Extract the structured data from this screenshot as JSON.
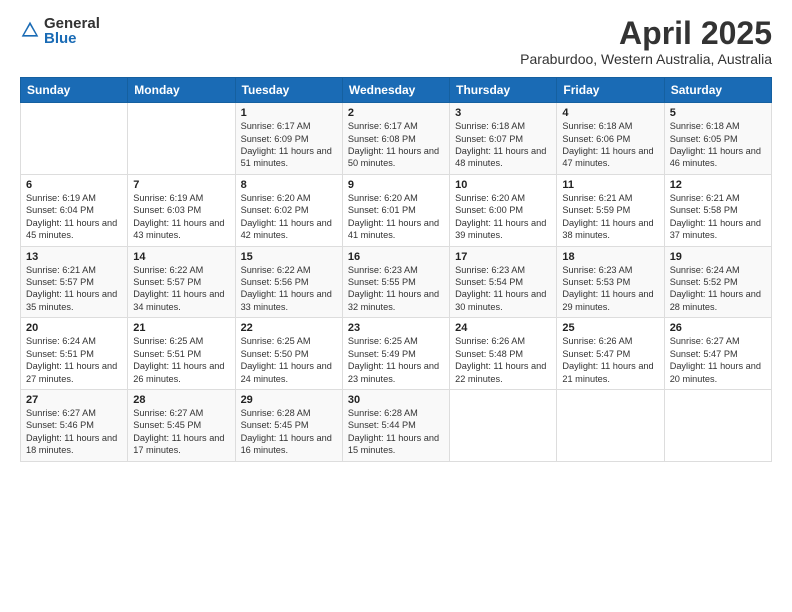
{
  "header": {
    "logo_general": "General",
    "logo_blue": "Blue",
    "month_title": "April 2025",
    "subtitle": "Paraburdoo, Western Australia, Australia"
  },
  "calendar": {
    "days_of_week": [
      "Sunday",
      "Monday",
      "Tuesday",
      "Wednesday",
      "Thursday",
      "Friday",
      "Saturday"
    ],
    "weeks": [
      [
        {
          "num": "",
          "info": ""
        },
        {
          "num": "",
          "info": ""
        },
        {
          "num": "1",
          "info": "Sunrise: 6:17 AM\nSunset: 6:09 PM\nDaylight: 11 hours and 51 minutes."
        },
        {
          "num": "2",
          "info": "Sunrise: 6:17 AM\nSunset: 6:08 PM\nDaylight: 11 hours and 50 minutes."
        },
        {
          "num": "3",
          "info": "Sunrise: 6:18 AM\nSunset: 6:07 PM\nDaylight: 11 hours and 48 minutes."
        },
        {
          "num": "4",
          "info": "Sunrise: 6:18 AM\nSunset: 6:06 PM\nDaylight: 11 hours and 47 minutes."
        },
        {
          "num": "5",
          "info": "Sunrise: 6:18 AM\nSunset: 6:05 PM\nDaylight: 11 hours and 46 minutes."
        }
      ],
      [
        {
          "num": "6",
          "info": "Sunrise: 6:19 AM\nSunset: 6:04 PM\nDaylight: 11 hours and 45 minutes."
        },
        {
          "num": "7",
          "info": "Sunrise: 6:19 AM\nSunset: 6:03 PM\nDaylight: 11 hours and 43 minutes."
        },
        {
          "num": "8",
          "info": "Sunrise: 6:20 AM\nSunset: 6:02 PM\nDaylight: 11 hours and 42 minutes."
        },
        {
          "num": "9",
          "info": "Sunrise: 6:20 AM\nSunset: 6:01 PM\nDaylight: 11 hours and 41 minutes."
        },
        {
          "num": "10",
          "info": "Sunrise: 6:20 AM\nSunset: 6:00 PM\nDaylight: 11 hours and 39 minutes."
        },
        {
          "num": "11",
          "info": "Sunrise: 6:21 AM\nSunset: 5:59 PM\nDaylight: 11 hours and 38 minutes."
        },
        {
          "num": "12",
          "info": "Sunrise: 6:21 AM\nSunset: 5:58 PM\nDaylight: 11 hours and 37 minutes."
        }
      ],
      [
        {
          "num": "13",
          "info": "Sunrise: 6:21 AM\nSunset: 5:57 PM\nDaylight: 11 hours and 35 minutes."
        },
        {
          "num": "14",
          "info": "Sunrise: 6:22 AM\nSunset: 5:57 PM\nDaylight: 11 hours and 34 minutes."
        },
        {
          "num": "15",
          "info": "Sunrise: 6:22 AM\nSunset: 5:56 PM\nDaylight: 11 hours and 33 minutes."
        },
        {
          "num": "16",
          "info": "Sunrise: 6:23 AM\nSunset: 5:55 PM\nDaylight: 11 hours and 32 minutes."
        },
        {
          "num": "17",
          "info": "Sunrise: 6:23 AM\nSunset: 5:54 PM\nDaylight: 11 hours and 30 minutes."
        },
        {
          "num": "18",
          "info": "Sunrise: 6:23 AM\nSunset: 5:53 PM\nDaylight: 11 hours and 29 minutes."
        },
        {
          "num": "19",
          "info": "Sunrise: 6:24 AM\nSunset: 5:52 PM\nDaylight: 11 hours and 28 minutes."
        }
      ],
      [
        {
          "num": "20",
          "info": "Sunrise: 6:24 AM\nSunset: 5:51 PM\nDaylight: 11 hours and 27 minutes."
        },
        {
          "num": "21",
          "info": "Sunrise: 6:25 AM\nSunset: 5:51 PM\nDaylight: 11 hours and 26 minutes."
        },
        {
          "num": "22",
          "info": "Sunrise: 6:25 AM\nSunset: 5:50 PM\nDaylight: 11 hours and 24 minutes."
        },
        {
          "num": "23",
          "info": "Sunrise: 6:25 AM\nSunset: 5:49 PM\nDaylight: 11 hours and 23 minutes."
        },
        {
          "num": "24",
          "info": "Sunrise: 6:26 AM\nSunset: 5:48 PM\nDaylight: 11 hours and 22 minutes."
        },
        {
          "num": "25",
          "info": "Sunrise: 6:26 AM\nSunset: 5:47 PM\nDaylight: 11 hours and 21 minutes."
        },
        {
          "num": "26",
          "info": "Sunrise: 6:27 AM\nSunset: 5:47 PM\nDaylight: 11 hours and 20 minutes."
        }
      ],
      [
        {
          "num": "27",
          "info": "Sunrise: 6:27 AM\nSunset: 5:46 PM\nDaylight: 11 hours and 18 minutes."
        },
        {
          "num": "28",
          "info": "Sunrise: 6:27 AM\nSunset: 5:45 PM\nDaylight: 11 hours and 17 minutes."
        },
        {
          "num": "29",
          "info": "Sunrise: 6:28 AM\nSunset: 5:45 PM\nDaylight: 11 hours and 16 minutes."
        },
        {
          "num": "30",
          "info": "Sunrise: 6:28 AM\nSunset: 5:44 PM\nDaylight: 11 hours and 15 minutes."
        },
        {
          "num": "",
          "info": ""
        },
        {
          "num": "",
          "info": ""
        },
        {
          "num": "",
          "info": ""
        }
      ]
    ]
  }
}
